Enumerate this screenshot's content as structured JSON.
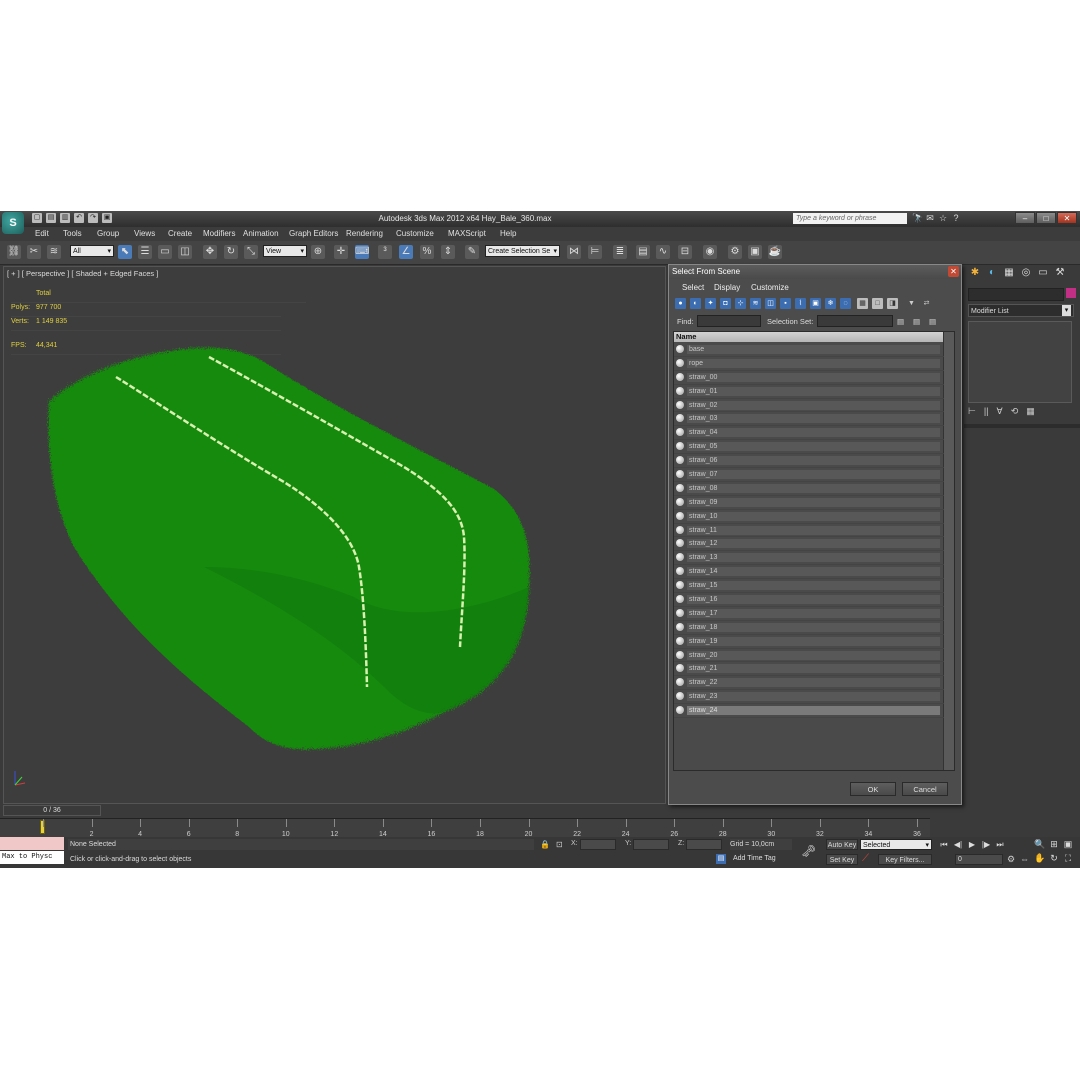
{
  "app": {
    "title": "Autodesk 3ds Max  2012 x64     Hay_Bale_360.max",
    "search_placeholder": "Type a keyword or phrase",
    "logo_glyph": "S",
    "window_buttons": [
      "–",
      "□",
      "✕"
    ]
  },
  "quick_access": [
    "▢",
    "▤",
    "▥",
    "↶",
    "↷",
    "▣"
  ],
  "title_icons": [
    "🔭",
    "✉",
    "☆",
    "?"
  ],
  "menu": [
    "Edit",
    "Tools",
    "Group",
    "Views",
    "Create",
    "Modifiers",
    "Animation",
    "Graph Editors",
    "Rendering",
    "Customize",
    "MAXScript",
    "Help"
  ],
  "toolbar": {
    "selection_filter": "All",
    "reference_coord": "View",
    "named_selection": "Create Selection Se"
  },
  "viewport": {
    "label": "[ + ] [ Perspective ] [ Shaded + Edged Faces ]",
    "stats": {
      "total_label": "Total",
      "polys_label": "Polys:",
      "polys": "977 700",
      "verts_label": "Verts:",
      "verts": "1 149 835",
      "fps_label": "FPS:",
      "fps": "44,341"
    },
    "colors": {
      "hay": "#148a10",
      "rope": "#d8f0b0"
    }
  },
  "command_panel": {
    "tabs": [
      "✱",
      "◐",
      "▦",
      "◎",
      "▭",
      "⚒"
    ],
    "modifier_list": "Modifier List",
    "stack_tools": [
      "⊢",
      "||",
      "∀",
      "⟲",
      "▦"
    ]
  },
  "dialog": {
    "title": "Select From Scene",
    "menu": [
      "Select",
      "Display",
      "Customize"
    ],
    "find_label": "Find:",
    "selection_set_label": "Selection Set:",
    "column_header": "Name",
    "items": [
      "base",
      "rope",
      "straw_00",
      "straw_01",
      "straw_02",
      "straw_03",
      "straw_04",
      "straw_05",
      "straw_06",
      "straw_07",
      "straw_08",
      "straw_09",
      "straw_10",
      "straw_11",
      "straw_12",
      "straw_13",
      "straw_14",
      "straw_15",
      "straw_16",
      "straw_17",
      "straw_18",
      "straw_19",
      "straw_20",
      "straw_21",
      "straw_22",
      "straw_23",
      "straw_24"
    ],
    "selected_item": "straw_24",
    "ok_label": "OK",
    "cancel_label": "Cancel"
  },
  "timeline": {
    "slider_label": "0 / 36",
    "ticks": [
      "0",
      "2",
      "4",
      "6",
      "8",
      "10",
      "12",
      "14",
      "16",
      "18",
      "20",
      "22",
      "24",
      "26",
      "28",
      "30",
      "32",
      "34",
      "36"
    ]
  },
  "status": {
    "maxscript": "Max to Physc",
    "selection": "None Selected",
    "prompt": "Click or click-and-drag to select objects",
    "x_label": "X:",
    "y_label": "Y:",
    "z_label": "Z:",
    "grid": "Grid = 10,0cm",
    "add_time_tag": "Add Time Tag",
    "auto_key": "Auto Key",
    "set_key": "Set Key",
    "key_mode": "Selected",
    "key_filters": "Key Filters...",
    "frame": "0"
  },
  "playback": [
    "⏮",
    "◀|",
    "▶",
    "|▶",
    "⏭"
  ],
  "nav_icons": [
    "🔍",
    "⊞",
    "▣",
    "✋",
    "↻",
    "⛶"
  ]
}
